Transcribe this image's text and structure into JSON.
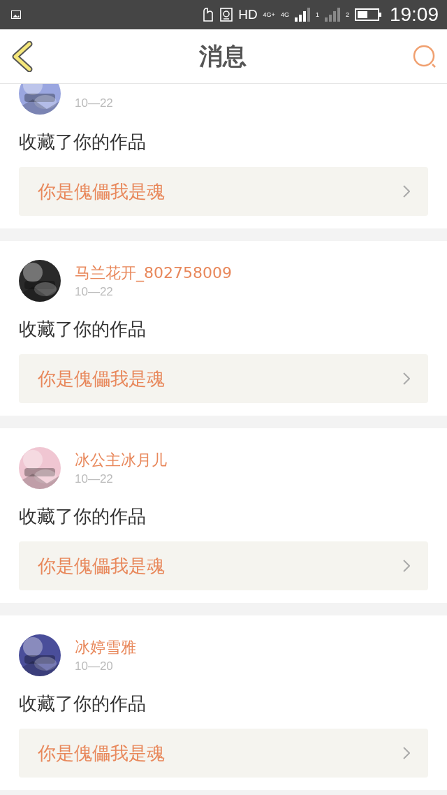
{
  "status_bar": {
    "network": "HD",
    "sim1_type": "4G+",
    "sim2_type": "4G",
    "sim1_label": "1",
    "sim2_label": "2",
    "time": "19:09"
  },
  "header": {
    "title": "消息"
  },
  "messages": [
    {
      "date": "10—22",
      "action": "收藏了你的作品",
      "work": "你是傀儡我是魂"
    },
    {
      "name": "马兰花开_802758009",
      "date": "10—22",
      "action": "收藏了你的作品",
      "work": "你是傀儡我是魂"
    },
    {
      "name": "冰公主冰月儿",
      "date": "10—22",
      "action": "收藏了你的作品",
      "work": "你是傀儡我是魂"
    },
    {
      "name": "冰婷雪雅",
      "date": "10—20",
      "action": "收藏了你的作品",
      "work": "你是傀儡我是魂"
    }
  ]
}
